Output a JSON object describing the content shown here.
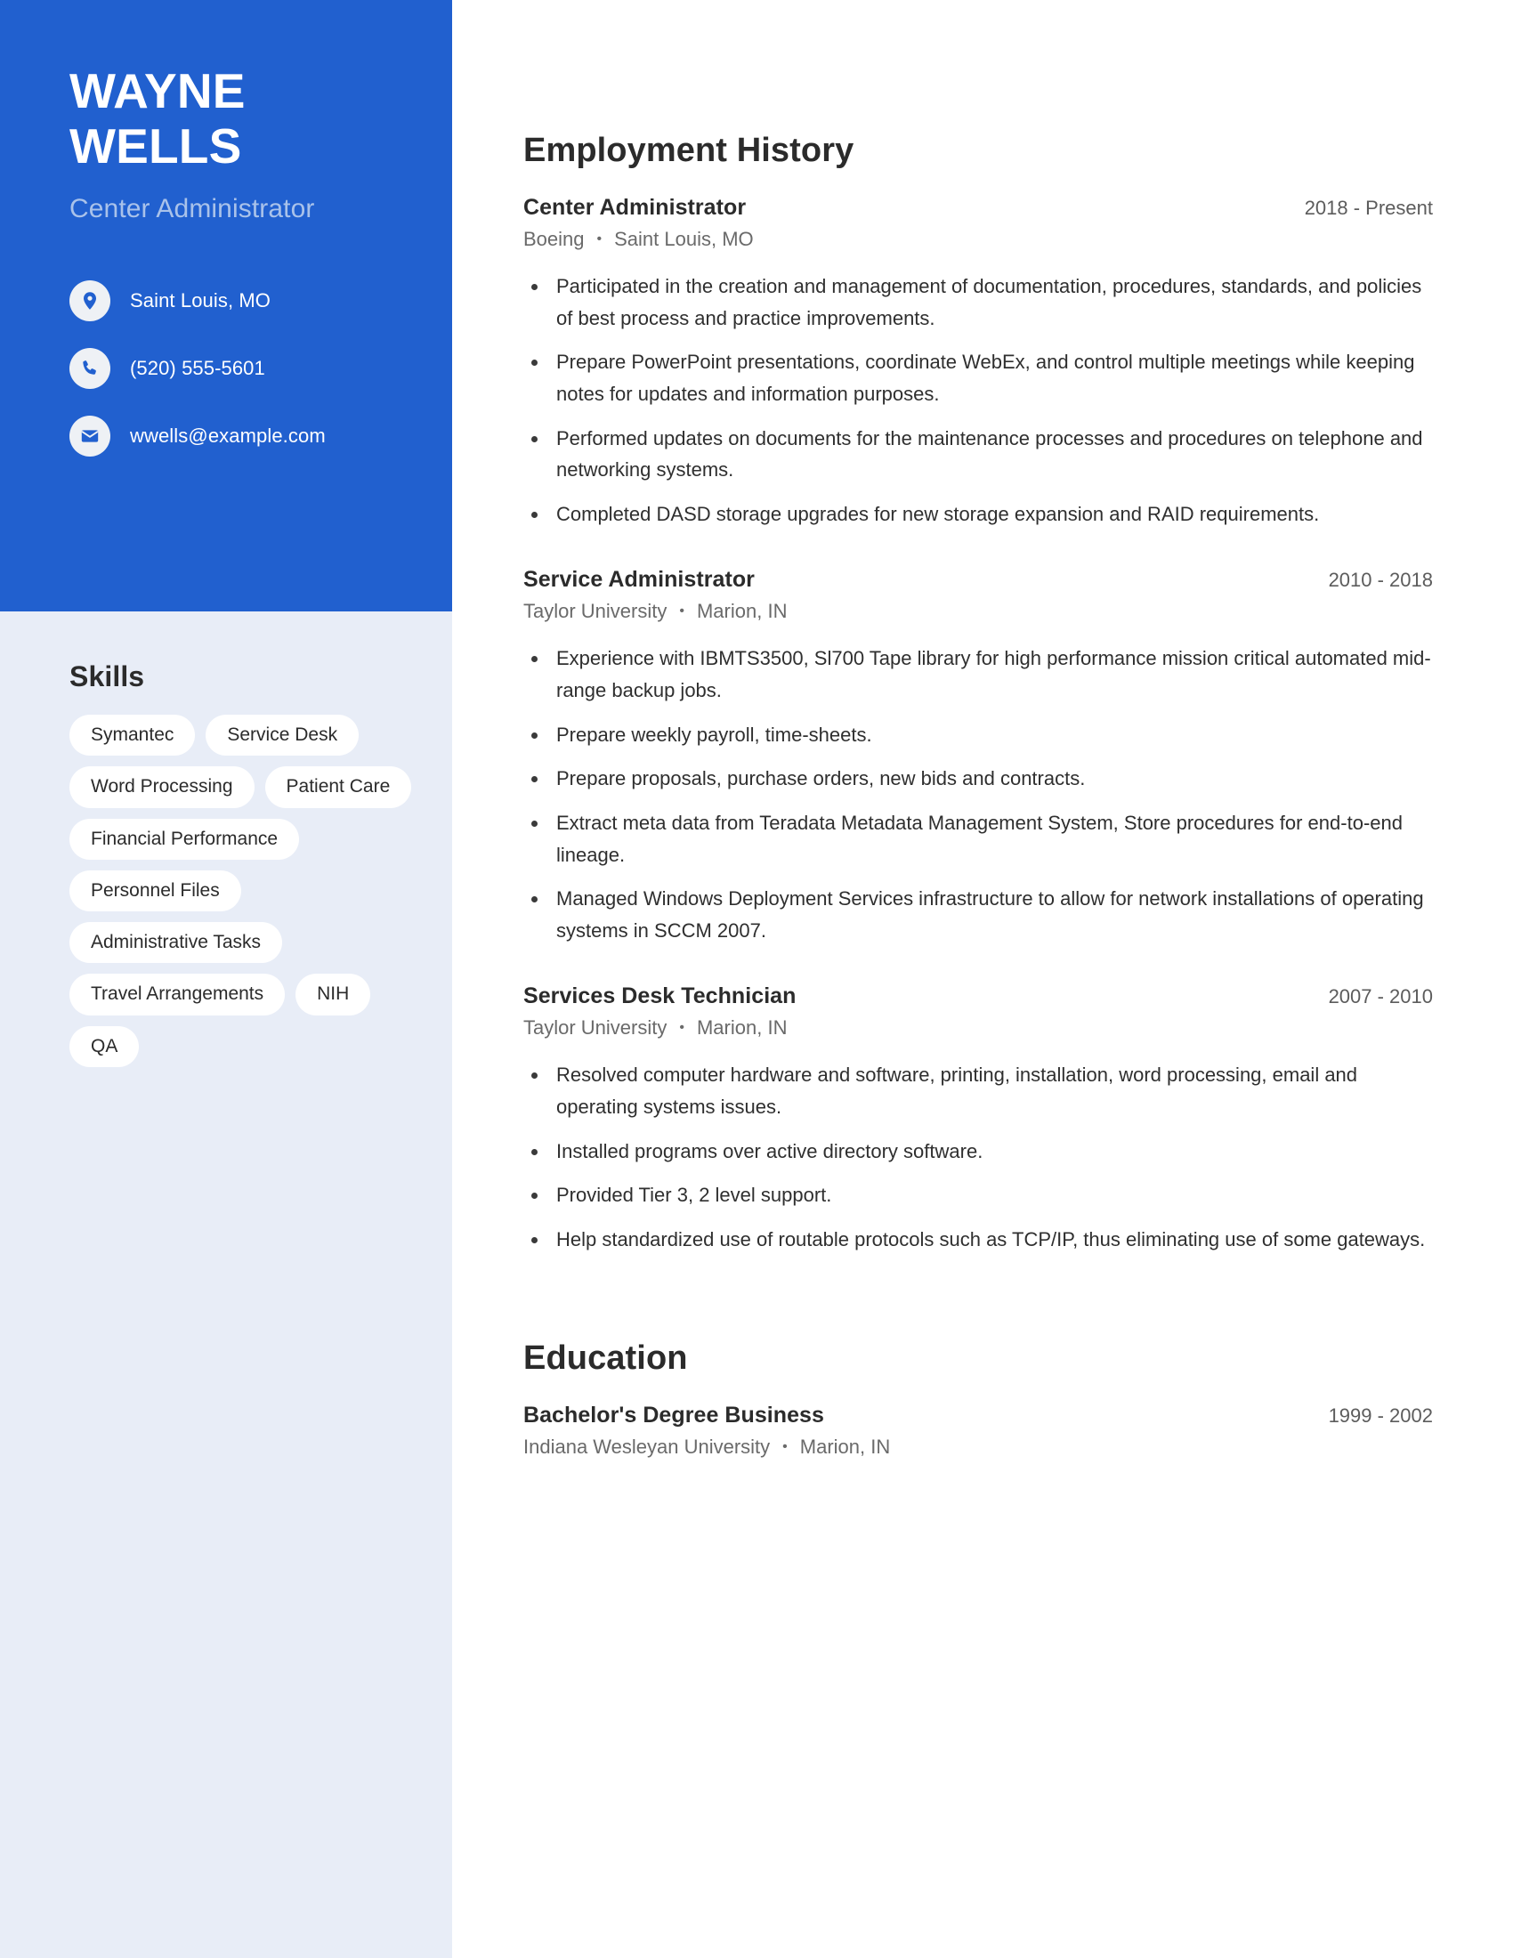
{
  "theme": {
    "sidebar_blue": "#2160cf",
    "sidebar_light": "#e8edf7",
    "subtitle_blue": "#a9c2ea",
    "text_dark": "#2b2b2b",
    "text_muted": "#6a6a6a",
    "pill_bg": "#ffffff"
  },
  "sidebar": {
    "name_first": "WAYNE",
    "name_last": "WELLS",
    "job_title": "Center Administrator",
    "contacts": [
      {
        "icon": "location-pin-icon",
        "value": "Saint Louis, MO"
      },
      {
        "icon": "phone-icon",
        "value": "(520) 555-5601"
      },
      {
        "icon": "envelope-icon",
        "value": "wwells@example.com"
      }
    ],
    "skills_heading": "Skills",
    "skills": [
      "Symantec",
      "Service Desk",
      "Word Processing",
      "Patient Care",
      "Financial Performance",
      "Personnel Files",
      "Administrative Tasks",
      "Travel Arrangements",
      "NIH",
      "QA"
    ]
  },
  "main": {
    "employment": {
      "title": "Employment History",
      "entries": [
        {
          "role": "Center Administrator",
          "dates": "2018 - Present",
          "company": "Boeing",
          "location": "Saint Louis, MO",
          "bullets": [
            "Participated in the creation and management of documentation, procedures, standards, and policies of best process and practice improvements.",
            "Prepare PowerPoint presentations, coordinate WebEx, and control multiple meetings while keeping notes for updates and information purposes.",
            "Performed updates on documents for the maintenance processes and procedures on telephone and networking systems.",
            "Completed DASD storage upgrades for new storage expansion and RAID requirements."
          ]
        },
        {
          "role": "Service Administrator",
          "dates": "2010 - 2018",
          "company": "Taylor University",
          "location": "Marion, IN",
          "bullets": [
            "Experience with IBMTS3500, Sl700 Tape library for high performance mission critical automated mid-range backup jobs.",
            "Prepare weekly payroll, time-sheets.",
            "Prepare proposals, purchase orders, new bids and contracts.",
            "Extract meta data from Teradata Metadata Management System, Store procedures for end-to-end lineage.",
            "Managed Windows Deployment Services infrastructure to allow for network installations of operating systems in SCCM 2007."
          ]
        },
        {
          "role": "Services Desk Technician",
          "dates": "2007 - 2010",
          "company": "Taylor University",
          "location": "Marion, IN",
          "bullets": [
            "Resolved computer hardware and software, printing, installation, word processing, email and operating systems issues.",
            "Installed programs over active directory software.",
            "Provided Tier 3, 2 level support.",
            "Help standardized use of routable protocols such as TCP/IP, thus eliminating use of some gateways."
          ]
        }
      ]
    },
    "education": {
      "title": "Education",
      "entries": [
        {
          "degree": "Bachelor's Degree Business",
          "dates": "1999 - 2002",
          "school": "Indiana Wesleyan University",
          "location": "Marion, IN"
        }
      ]
    },
    "separator": "•"
  }
}
